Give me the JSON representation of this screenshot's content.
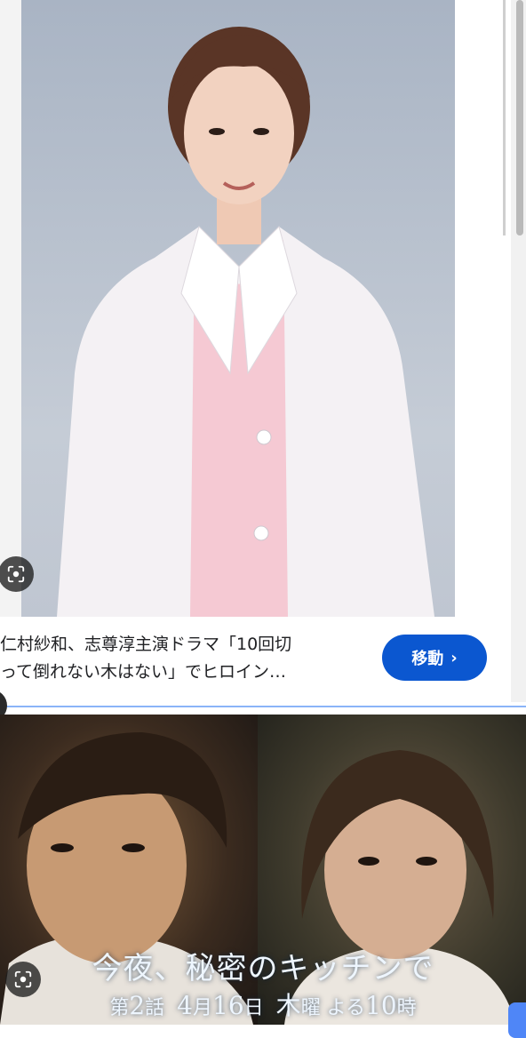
{
  "result1": {
    "image_alt": "White lab coat portrait",
    "caption_line1": "仁村紗和、志尊淳主演ドラマ「10回切",
    "caption_line2": "って倒れない木はない」でヒロイン…",
    "visit_label": "移動",
    "visit_icon": "chevron-right-icon"
  },
  "result2": {
    "title": "今夜、秘密のキッチンで",
    "episode_prefix": "第",
    "episode_num": "2",
    "episode_suffix": "話",
    "month": "4",
    "month_unit": "月",
    "day": "16",
    "day_unit": "日",
    "weekday": "木",
    "weekday_suffix": "曜 よる",
    "hour": "10",
    "hour_unit": "時"
  },
  "icons": {
    "lens": "google-lens-icon"
  },
  "colors": {
    "accent": "#0b57d0",
    "divider": "#8ab4f8"
  }
}
